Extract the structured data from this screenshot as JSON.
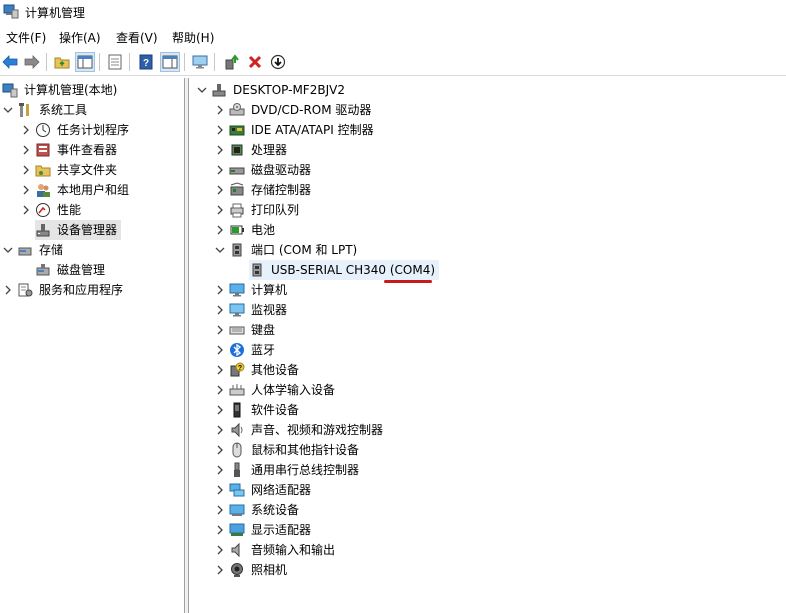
{
  "window": {
    "title": "计算机管理"
  },
  "menu": {
    "file": "文件(F)",
    "action": "操作(A)",
    "view": "查看(V)",
    "help": "帮助(H)"
  },
  "left_tree": {
    "root": "计算机管理(本地)",
    "system_tools": "系统工具",
    "task_scheduler": "任务计划程序",
    "event_viewer": "事件查看器",
    "shared_folders": "共享文件夹",
    "local_users": "本地用户和组",
    "performance": "性能",
    "device_manager": "设备管理器",
    "storage": "存储",
    "disk_management": "磁盘管理",
    "services": "服务和应用程序"
  },
  "device_tree": {
    "computer_name": "DESKTOP-MF2BJV2",
    "categories": [
      {
        "label": "DVD/CD-ROM 驱动器",
        "icon": "dvd-icon"
      },
      {
        "label": "IDE ATA/ATAPI 控制器",
        "icon": "ide-icon"
      },
      {
        "label": "处理器",
        "icon": "cpu-icon"
      },
      {
        "label": "磁盘驱动器",
        "icon": "disk-icon"
      },
      {
        "label": "存储控制器",
        "icon": "storage-controller-icon"
      },
      {
        "label": "打印队列",
        "icon": "printer-icon"
      },
      {
        "label": "电池",
        "icon": "battery-icon"
      },
      {
        "label": "端口 (COM 和 LPT)",
        "icon": "port-icon"
      },
      {
        "label": "计算机",
        "icon": "computer-icon"
      },
      {
        "label": "监视器",
        "icon": "monitor-icon"
      },
      {
        "label": "键盘",
        "icon": "keyboard-icon"
      },
      {
        "label": "蓝牙",
        "icon": "bluetooth-icon"
      },
      {
        "label": "其他设备",
        "icon": "other-device-icon"
      },
      {
        "label": "人体学输入设备",
        "icon": "hid-icon"
      },
      {
        "label": "软件设备",
        "icon": "software-device-icon"
      },
      {
        "label": "声音、视频和游戏控制器",
        "icon": "sound-icon"
      },
      {
        "label": "鼠标和其他指针设备",
        "icon": "mouse-icon"
      },
      {
        "label": "通用串行总线控制器",
        "icon": "usb-icon"
      },
      {
        "label": "网络适配器",
        "icon": "network-icon"
      },
      {
        "label": "系统设备",
        "icon": "system-device-icon"
      },
      {
        "label": "显示适配器",
        "icon": "display-adapter-icon"
      },
      {
        "label": "音频输入和输出",
        "icon": "audio-io-icon"
      },
      {
        "label": "照相机",
        "icon": "camera-icon"
      }
    ],
    "port_child": "USB-SERIAL CH340 (COM4)"
  },
  "colors": {
    "selection": "#e5e5e5",
    "highlight": "#e6f1fb",
    "underline": "#c8191c"
  }
}
